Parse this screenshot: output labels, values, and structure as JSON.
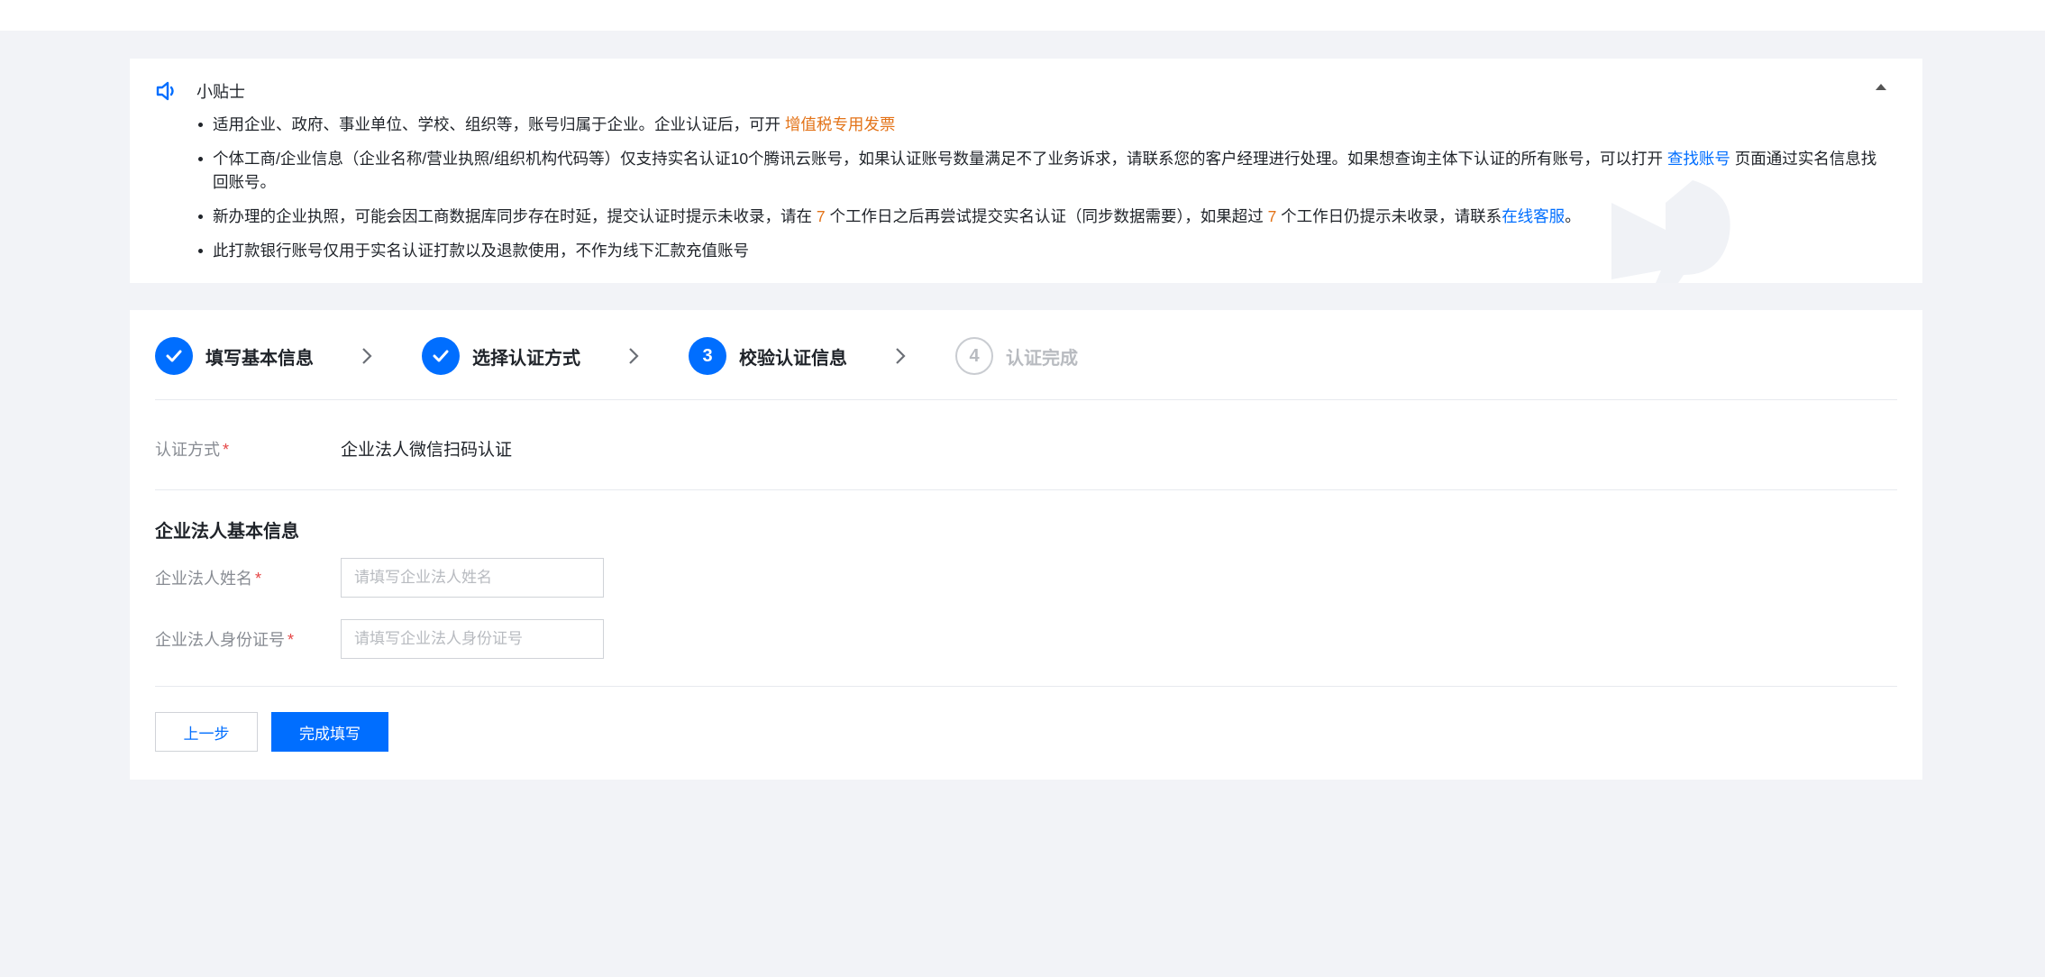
{
  "tips": {
    "title": "小贴士",
    "items": [
      {
        "text": "适用企业、政府、事业单位、学校、组织等，账号归属于企业。企业认证后，可开 ",
        "highlight": "增值税专用发票"
      },
      {
        "text_before": "个体工商/企业信息（企业名称/营业执照/组织机构代码等）仅支持实名认证10个腾讯云账号，如果认证账号数量满足不了业务诉求，请联系您的客户经理进行处理。如果想查询主体下认证的所有账号，可以打开 ",
        "link": "查找账号",
        "text_after": " 页面通过实名信息找回账号。"
      },
      {
        "part1": "新办理的企业执照，可能会因工商数据库同步存在时延，提交认证时提示未收录，请在 ",
        "days1": "7",
        "part2": " 个工作日之后再尝试提交实名认证（同步数据需要），如果超过 ",
        "days2": "7",
        "part3": " 个工作日仍提示未收录，请联系",
        "link": "在线客服",
        "part4": "。"
      },
      {
        "text": "此打款银行账号仅用于实名认证打款以及退款使用，不作为线下汇款充值账号"
      }
    ]
  },
  "steps": [
    {
      "number": "1",
      "label": "填写基本信息",
      "status": "done"
    },
    {
      "number": "2",
      "label": "选择认证方式",
      "status": "done"
    },
    {
      "number": "3",
      "label": "校验认证信息",
      "status": "current"
    },
    {
      "number": "4",
      "label": "认证完成",
      "status": "todo"
    }
  ],
  "form": {
    "method_label": "认证方式",
    "method_value": "企业法人微信扫码认证",
    "required_mark": "*",
    "section_title": "企业法人基本信息",
    "name_label": "企业法人姓名",
    "name_placeholder": "请填写企业法人姓名",
    "id_label": "企业法人身份证号",
    "id_placeholder": "请填写企业法人身份证号"
  },
  "buttons": {
    "prev": "上一步",
    "finish": "完成填写"
  },
  "colors": {
    "primary": "#006eff",
    "highlight": "#e37318",
    "background": "#f2f3f7"
  }
}
